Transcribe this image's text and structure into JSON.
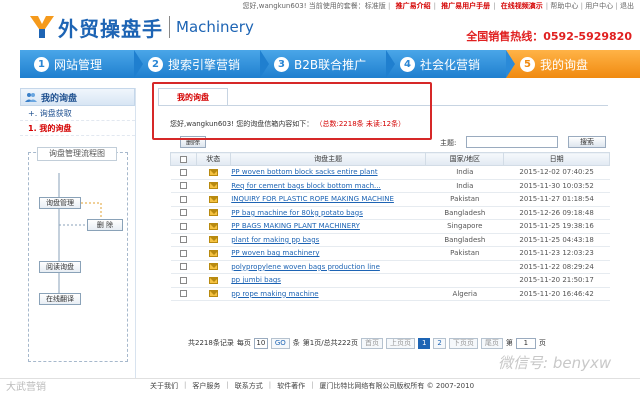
{
  "topbar": {
    "greeting": "您好,wangkun603! 当前使用的套餐：标准版",
    "links": [
      {
        "label": "推广易介绍",
        "red": true
      },
      {
        "label": "推广易用户手册",
        "red": true
      },
      {
        "label": "在线视频演示",
        "red": true
      },
      {
        "label": "帮助中心",
        "red": false
      },
      {
        "label": "用户中心",
        "red": false
      },
      {
        "label": "退出",
        "red": false
      }
    ]
  },
  "logo": {
    "cn": "外贸操盘手",
    "en": "Machinery"
  },
  "hotline": "全国销售热线：0592-5929820",
  "nav": [
    {
      "num": "1",
      "label": "网站管理"
    },
    {
      "num": "2",
      "label": "搜索引擎营销"
    },
    {
      "num": "3",
      "label": "B2B联合推广"
    },
    {
      "num": "4",
      "label": "社会化营销"
    },
    {
      "num": "5",
      "label": "我的询盘"
    }
  ],
  "sidebar": {
    "title": "我的询盘",
    "items": [
      {
        "label": "+. 询盘获取",
        "active": false
      },
      {
        "label": "1. 我的询盘",
        "active": true
      }
    ],
    "flow": {
      "title": "询盘管理流程图",
      "steps": [
        "询盘管理",
        "删 除",
        "阅读询盘",
        "在线翻译"
      ]
    }
  },
  "main": {
    "tab": "我的询盘",
    "greeting": "您好,wangkun603! 您的询盘信箱内容如下：",
    "counts": "（总数:2218条  未读:12条）",
    "delete_label": "删除",
    "keyword_label": "主题:",
    "search_label": "搜索",
    "columns": [
      "状态",
      "询盘主题",
      "国家/地区",
      "日期"
    ],
    "rows": [
      {
        "subject": "PP woven bottom block sacks entire plant",
        "country": "India",
        "date": "2015-12-02 07:40:25"
      },
      {
        "subject": "Req for cement bags block bottom mach...",
        "country": "India",
        "date": "2015-11-30 10:03:52"
      },
      {
        "subject": "INQUIRY FOR PLASTIC ROPE MAKING MACHINE",
        "country": "Pakistan",
        "date": "2015-11-27 01:18:54"
      },
      {
        "subject": "PP bag machine for 80kg potato bags",
        "country": "Bangladesh",
        "date": "2015-12-26 09:18:48"
      },
      {
        "subject": "PP BAGS MAKING PLANT MACHINERY",
        "country": "Singapore",
        "date": "2015-11-25 19:38:16"
      },
      {
        "subject": "plant for making pp bags",
        "country": "Bangladesh",
        "date": "2015-11-25 04:43:18"
      },
      {
        "subject": "PP woven bag machinery",
        "country": "Pakistan",
        "date": "2015-11-23 12:03:23"
      },
      {
        "subject": "polypropylene woven bags production line",
        "country": "",
        "date": "2015-11-22 08:29:24"
      },
      {
        "subject": "pp jumbi bags",
        "country": "",
        "date": "2015-11-20 21:50:17"
      },
      {
        "subject": "pp rope making machine",
        "country": "Algeria",
        "date": "2015-11-20 16:46:42"
      }
    ],
    "pager": {
      "total": "共2218条记录",
      "per_page_label": "每页",
      "per_page": "10",
      "go": "GO",
      "unit": "条",
      "page_info": "第1页/总共222页",
      "first": "首页",
      "prev": "上页页",
      "current": "1",
      "next_num": "2",
      "next": "下页页",
      "last": "尾页",
      "page_label": "第",
      "page_value": "1",
      "page_suffix": "页"
    }
  },
  "footer": {
    "links": [
      "关于我们",
      "客户服务",
      "联系方式",
      "软件著作"
    ],
    "copyright": "厦门比特比网络有限公司版权所有 © 2007-2010"
  },
  "watermarks": {
    "left": "大武营销",
    "right": "微信号: benyxw"
  },
  "colors": {
    "brand_blue": "#1d64b4",
    "nav_blue": "#2a8ad8",
    "nav_active": "#f08a10",
    "alert_red": "#d62828"
  }
}
